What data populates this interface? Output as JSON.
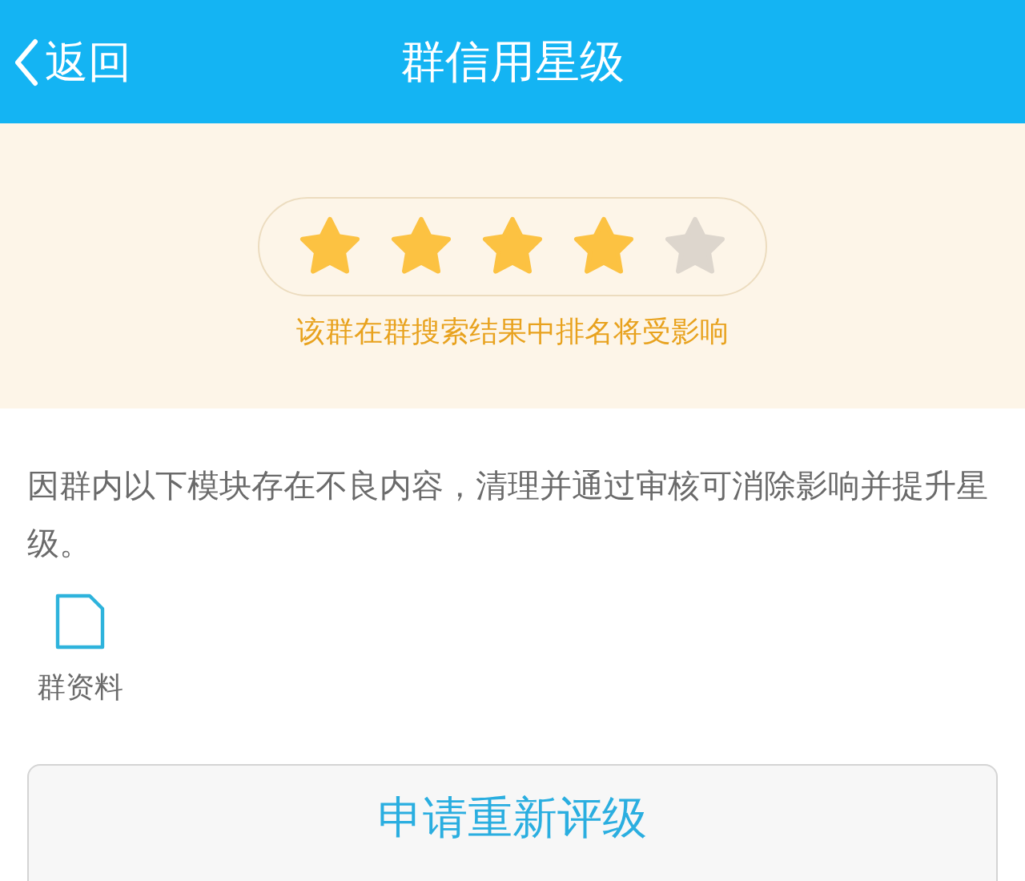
{
  "nav_bar": {
    "back_label": "返回",
    "title": "群信用星级"
  },
  "rating": {
    "stars": 4,
    "note": "该群在群搜索结果中排名将受影响"
  },
  "notice": "因群内以下模块存在不良内容，清理并通过审核可消除影响并提升星级。",
  "modules": [
    {
      "label": "群资料"
    }
  ],
  "buttons": [
    {
      "label": "申请重新评级"
    }
  ]
}
